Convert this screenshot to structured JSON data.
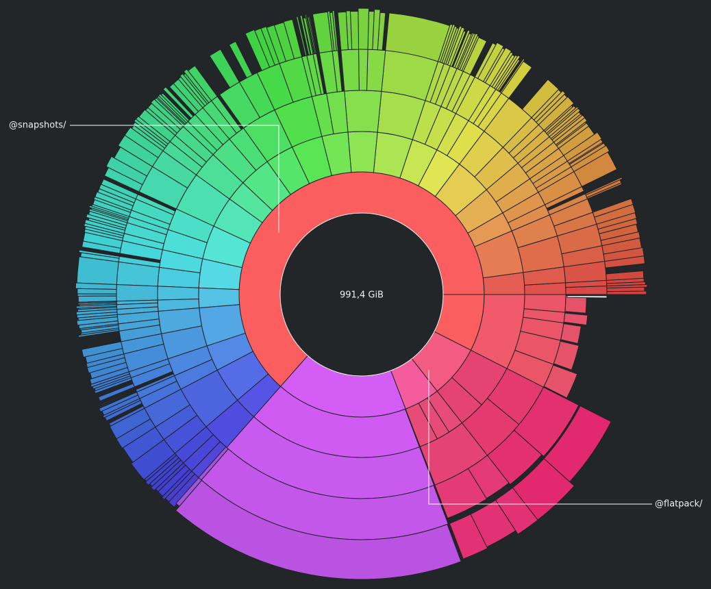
{
  "app": {
    "total_size": "991,4 GiB",
    "background": "#232629",
    "center_fill": "#232629",
    "label_color": "#eff0f1",
    "separator_color": "#1f2225"
  },
  "callouts": [
    {
      "id": "snapshots",
      "label": "@snapshots/",
      "side": "left",
      "target": "ring-1"
    },
    {
      "id": "flatpack",
      "label": "@flatpack/",
      "side": "right",
      "target": "ring-1"
    }
  ],
  "chart_data": {
    "type": "sunburst",
    "root": {
      "label": "991,4 GiB",
      "color": "#f95e5e",
      "share_of_circle": 1.0
    },
    "ring_1": [
      {
        "name": "@snapshots/",
        "share": 0.635,
        "color": "#f95e5e"
      },
      {
        "name": "@flatpack/",
        "share": 0.14,
        "color": "#cf5aee"
      },
      {
        "name": "",
        "share": 0.04,
        "color": "#ee5a8c"
      },
      {
        "name": "",
        "share": 0.185,
        "color": "#f95e5e"
      }
    ],
    "hue_wheel": {
      "start_color": "#e65b5b",
      "direction": "counterclockwise",
      "levels": 5
    }
  }
}
